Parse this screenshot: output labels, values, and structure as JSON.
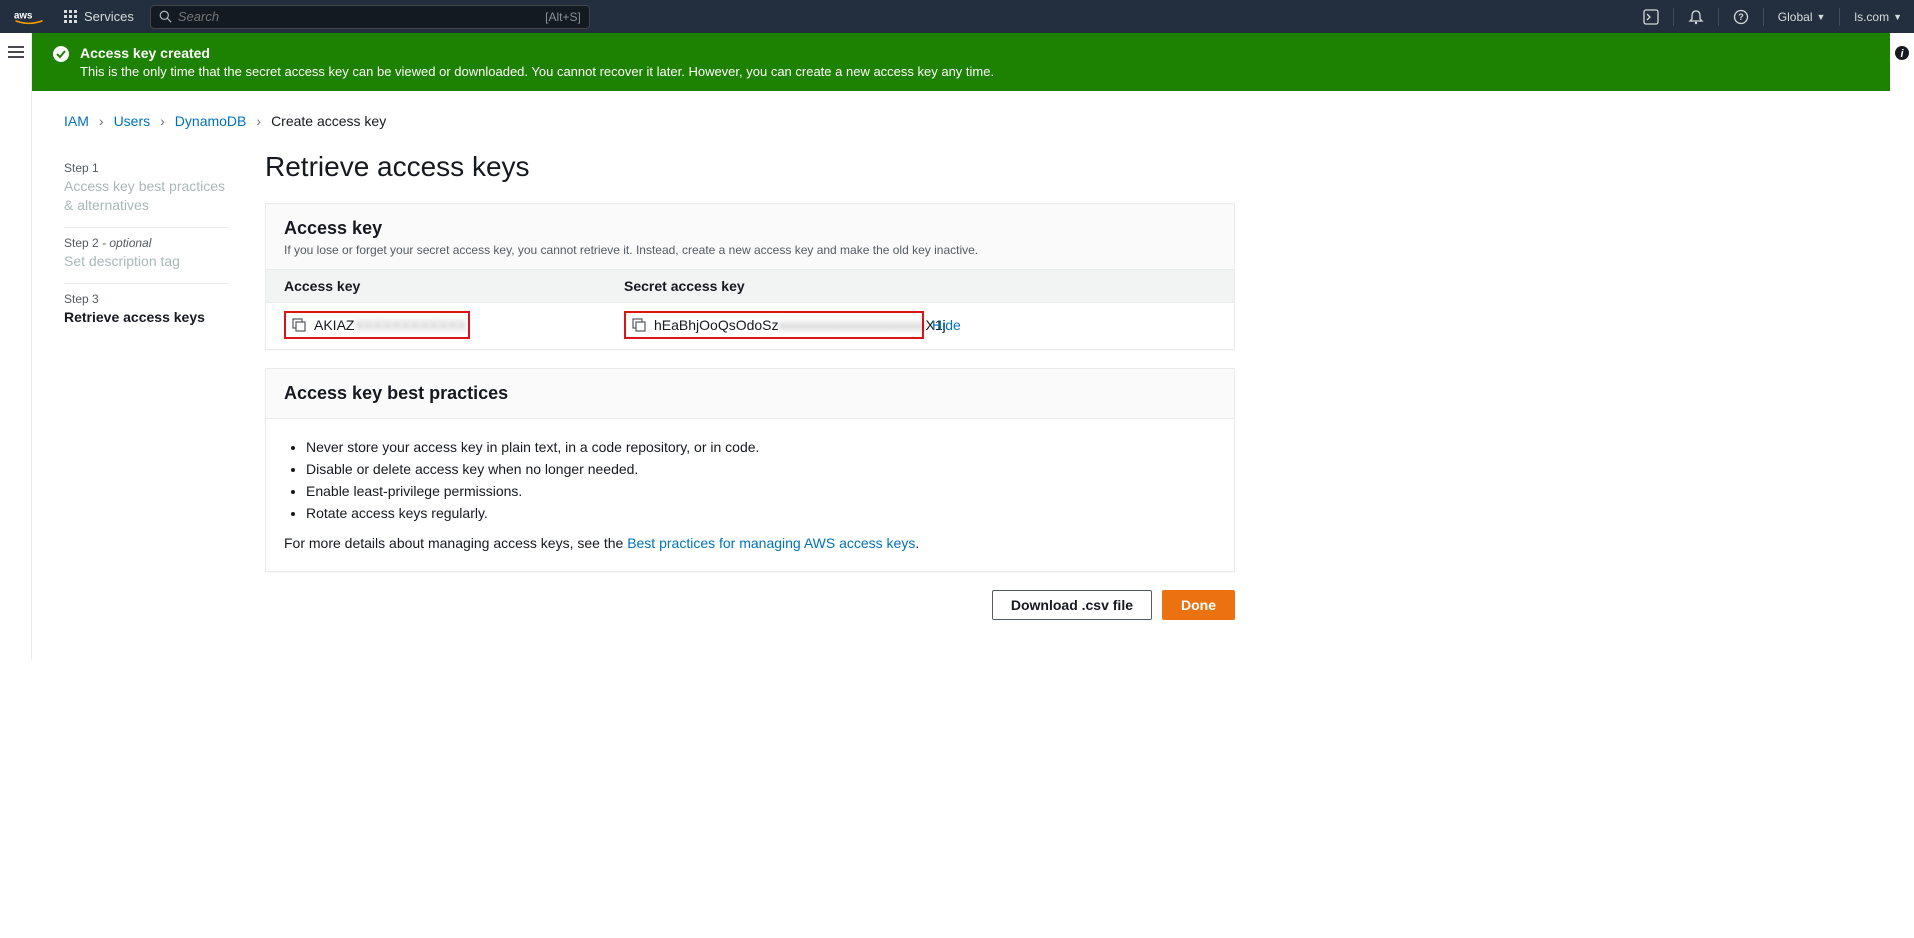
{
  "topbar": {
    "services_label": "Services",
    "search_placeholder": "Search",
    "search_kbd": "[Alt+S]",
    "region_label": "Global",
    "account_label": "ls.com"
  },
  "flash": {
    "title": "Access key created",
    "message": "This is the only time that the secret access key can be viewed or downloaded. You cannot recover it later. However, you can create a new access key any time."
  },
  "breadcrumb": {
    "items": [
      "IAM",
      "Users",
      "DynamoDB"
    ],
    "current": "Create access key"
  },
  "steps": [
    {
      "num": "Step 1",
      "title": "Access key best practices & alternatives",
      "optional": false
    },
    {
      "num": "Step 2 ",
      "optional_label": "- optional",
      "title": "Set description tag",
      "optional": true
    },
    {
      "num": "Step 3",
      "title": "Retrieve access keys",
      "optional": false
    }
  ],
  "page": {
    "title": "Retrieve access keys"
  },
  "access_key_panel": {
    "heading": "Access key",
    "subtext": "If you lose or forget your secret access key, you cannot retrieve it. Instead, create a new access key and make the old key inactive.",
    "col_access_key": "Access key",
    "col_secret": "Secret access key",
    "access_key_prefix": "AKIAZ",
    "access_key_redacted": "XXXXXXXXXXXX",
    "secret_prefix": "hEaBhjOoQsOdoSz",
    "secret_redacted": "xxxxxxxxxxxxxxxxxxxxx",
    "secret_suffix": "X1j",
    "hide_label": "Hide"
  },
  "best_practices": {
    "heading": "Access key best practices",
    "items": [
      "Never store your access key in plain text, in a code repository, or in code.",
      "Disable or delete access key when no longer needed.",
      "Enable least-privilege permissions.",
      "Rotate access keys regularly."
    ],
    "more_prefix": "For more details about managing access keys, see the ",
    "more_link": "Best practices for managing AWS access keys",
    "more_suffix": "."
  },
  "actions": {
    "download": "Download .csv file",
    "done": "Done"
  }
}
